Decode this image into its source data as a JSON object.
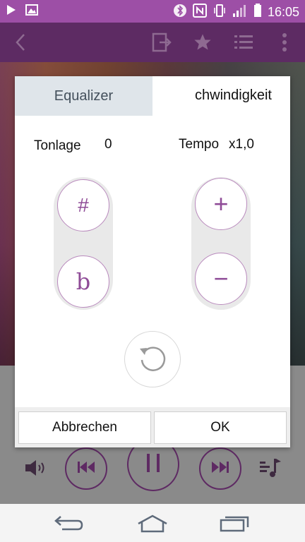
{
  "status_bar": {
    "time": "16:05",
    "icons": [
      "play-icon",
      "image-icon",
      "bluetooth-icon",
      "nfc-icon",
      "vibrate-icon",
      "signal-icon",
      "battery-icon"
    ]
  },
  "toolbar": {
    "icons": [
      "back-icon",
      "share-icon",
      "star-icon",
      "playlist-icon",
      "more-icon"
    ]
  },
  "dialog": {
    "tabs": [
      {
        "label": "Equalizer"
      },
      {
        "label": "chwindigkeit"
      }
    ],
    "pitch": {
      "label": "Tonlage",
      "value": "0",
      "up_symbol": "#",
      "down_symbol": "b"
    },
    "tempo": {
      "label": "Tempo",
      "value": "x1,0",
      "up_symbol": "+",
      "down_symbol": "−"
    },
    "buttons": {
      "cancel": "Abbrechen",
      "ok": "OK"
    }
  },
  "player": {
    "icons": [
      "volume-icon",
      "previous-icon",
      "pause-icon",
      "next-icon",
      "queue-icon"
    ]
  },
  "nav_bar": {
    "icons": [
      "nav-back-icon",
      "home-icon",
      "recents-icon"
    ]
  },
  "colors": {
    "status_bar": "#9d4fa6",
    "toolbar": "#5d2b63",
    "accent": "#8f4c97",
    "tab_inactive": "#dfe5ea"
  }
}
